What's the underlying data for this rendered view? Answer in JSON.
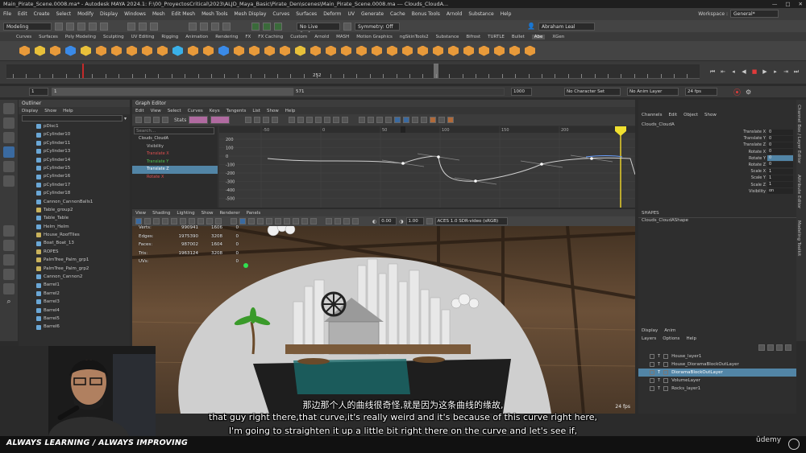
{
  "window": {
    "title": "Main_Pirate_Scene.0008.ma* - Autodesk MAYA 2024.1: F:\\00_ProyectosCritical\\2023\\ALJD_Maya_Basic\\Pirate_Den\\scenes\\Main_Pirate_Scene.0008.ma   ---   Clouds_CloudA..."
  },
  "menubar": {
    "items": [
      "File",
      "Edit",
      "Create",
      "Select",
      "Modify",
      "Display",
      "Windows",
      "Mesh",
      "Edit Mesh",
      "Mesh Tools",
      "Mesh Display",
      "Curves",
      "Surfaces",
      "Deform",
      "UV",
      "Generate",
      "Cache",
      "Bonus Tools",
      "Arnold",
      "Substance",
      "Help"
    ],
    "workspace_label": "Workspace :",
    "workspace_value": "General*"
  },
  "statusline": {
    "mode": "Modeling",
    "live_surface": "No Live Surface",
    "symmetry": "Symmetry: Off",
    "user": "Abraham Leal"
  },
  "shelf": {
    "tabs": [
      "Curves",
      "Surfaces",
      "Poly Modeling",
      "Sculpting",
      "UV Editing",
      "Rigging",
      "Animation",
      "Rendering",
      "FX",
      "FX Caching",
      "Custom",
      "Arnold",
      "MASH",
      "Motion Graphics",
      "ngSkinTools2",
      "Substance",
      "Bifrost",
      "TURTLE",
      "Bullet",
      "Abe",
      "XGen"
    ],
    "active_tab": "Abe",
    "icon_labels": [
      "HIM",
      "FT",
      "CP"
    ]
  },
  "timeslider": {
    "current_frame": "252",
    "range_start": "1",
    "range_current": "1",
    "range_end_inner": "571",
    "range_end": "1000",
    "character_set": "No Character Set",
    "anim_layer": "No Anim Layer",
    "fps": "24 fps",
    "tick_labels": [
      "5",
      "10",
      "15",
      "20",
      "25",
      "30",
      "35",
      "40",
      "45",
      "50",
      "55",
      "60",
      "65",
      "70",
      "75",
      "80",
      "85",
      "90",
      "95",
      "100",
      "105",
      "110",
      "115",
      "120",
      "125",
      "130",
      "135",
      "140",
      "145",
      "150",
      "155",
      "160",
      "165",
      "170",
      "175",
      "180",
      "185",
      "190",
      "195",
      "200",
      "205",
      "210",
      "215",
      "220",
      "225",
      "230",
      "235",
      "240",
      "245",
      "250",
      "255",
      "260"
    ]
  },
  "outliner": {
    "title": "Outliner",
    "menu": [
      "Display",
      "Show",
      "Help"
    ],
    "items": [
      {
        "label": "pDisc1",
        "group": false
      },
      {
        "label": "pCylinder10",
        "group": false
      },
      {
        "label": "pCylinder11",
        "group": false
      },
      {
        "label": "pCylinder13",
        "group": false
      },
      {
        "label": "pCylinder14",
        "group": false
      },
      {
        "label": "pCylinder15",
        "group": false
      },
      {
        "label": "pCylinder16",
        "group": false
      },
      {
        "label": "pCylinder17",
        "group": false
      },
      {
        "label": "pCylinder18",
        "group": false
      },
      {
        "label": "Cannon_CannonBalls1",
        "group": false
      },
      {
        "label": "Table_group2",
        "group": true
      },
      {
        "label": "Table_Table",
        "group": false
      },
      {
        "label": "Helm_Helm",
        "group": false
      },
      {
        "label": "House_RoofTiles",
        "group": true
      },
      {
        "label": "Boat_Boat_13",
        "group": false
      },
      {
        "label": "ROPES",
        "group": true
      },
      {
        "label": "PalmTree_Palm_grp1",
        "group": true
      },
      {
        "label": "PalmTree_Palm_grp2",
        "group": true
      },
      {
        "label": "Cannon_Cannon2",
        "group": false
      },
      {
        "label": "Barrel1",
        "group": false
      },
      {
        "label": "Barrel2",
        "group": false
      },
      {
        "label": "Barrel3",
        "group": false
      },
      {
        "label": "Barrel4",
        "group": false
      },
      {
        "label": "Barrel5",
        "group": false
      },
      {
        "label": "Barrel6",
        "group": false
      }
    ]
  },
  "grapheditor": {
    "title": "Graph Editor",
    "menu": [
      "Edit",
      "View",
      "Select",
      "Curves",
      "Keys",
      "Tangents",
      "List",
      "Show",
      "Help"
    ],
    "stats_label": "Stats",
    "search_placeholder": "Search...",
    "channels": [
      {
        "label": "Clouds_CloudA",
        "color": "#d0d0d0"
      },
      {
        "label": "Visibility",
        "color": "#c0c0c0"
      },
      {
        "label": "Translate X",
        "color": "#e05050"
      },
      {
        "label": "Translate Y",
        "color": "#50c050"
      },
      {
        "label": "Translate Z",
        "color": "#6aa0ff"
      },
      {
        "label": "Rotate X",
        "color": "#e05050"
      }
    ],
    "y_ticks": [
      "200",
      "100",
      "0",
      "-100",
      "-200",
      "-300",
      "-400",
      "-500"
    ],
    "x_ticks": [
      "-50",
      "0",
      "50",
      "100",
      "150",
      "200"
    ]
  },
  "viewport": {
    "menu": [
      "View",
      "Shading",
      "Lighting",
      "Show",
      "Renderer",
      "Panels"
    ],
    "exposure": "0.00",
    "gamma": "1.00",
    "color_space": "ACES 1.0 SDR-video (sRGB)",
    "hud": [
      {
        "label": "Verts:",
        "a": "990941",
        "b": "1606",
        "c": "0"
      },
      {
        "label": "Edges:",
        "a": "1975390",
        "b": "3208",
        "c": "0"
      },
      {
        "label": "Faces:",
        "a": "987002",
        "b": "1604",
        "c": "0"
      },
      {
        "label": "Tris:",
        "a": "1963124",
        "b": "3208",
        "c": "0"
      },
      {
        "label": "UVs:",
        "a": "",
        "b": "",
        "c": "0"
      }
    ],
    "fps": "24 fps"
  },
  "channelbox": {
    "tabs": [
      "Channels",
      "Edit",
      "Object",
      "Show"
    ],
    "object": "Clouds_CloudA",
    "attributes": [
      {
        "label": "Translate X",
        "value": "0"
      },
      {
        "label": "Translate Y",
        "value": "0"
      },
      {
        "label": "Translate Z",
        "value": "0"
      },
      {
        "label": "Rotate X",
        "value": "0"
      },
      {
        "label": "Rotate Y",
        "value": "0"
      },
      {
        "label": "Rotate Z",
        "value": "0"
      },
      {
        "label": "Scale X",
        "value": "1"
      },
      {
        "label": "Scale Y",
        "value": "1"
      },
      {
        "label": "Scale Z",
        "value": "1"
      },
      {
        "label": "Visibility",
        "value": "on"
      }
    ],
    "shapes_label": "SHAPES",
    "shape_name": "Clouds_CloudAShape"
  },
  "layers": {
    "tabs": [
      "Display",
      "Anim"
    ],
    "menu": [
      "Layers",
      "Options",
      "Help"
    ],
    "items": [
      {
        "label": "House_layer1",
        "selected": false
      },
      {
        "label": "House_DioramaBlockOutLayer",
        "selected": false
      },
      {
        "label": "DioramaBlockOutLayer",
        "selected": true
      },
      {
        "label": "VolumeLayer",
        "selected": false
      },
      {
        "label": "Rocks_layer1",
        "selected": false
      }
    ]
  },
  "side_tabs": [
    "Channel Box / Layer Editor",
    "Attribute Editor",
    "Modeling Toolkit"
  ],
  "subtitles": {
    "zh": "那边那个人的曲线很奇怪,就是因为这条曲线的缘故,",
    "en1": "that guy right there,that curve,it's really weird and it's because of this curve right here,",
    "en2": "I'm going to straighten it up a little bit right there on the curve and let's see if,"
  },
  "banner": {
    "text": "ALWAYS LEARNING / ALWAYS IMPROVING",
    "logo": "ûdemy"
  }
}
